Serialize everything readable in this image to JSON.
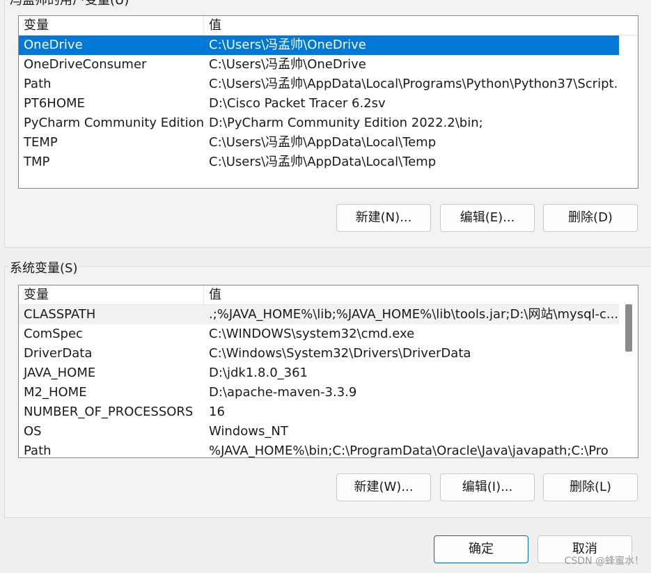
{
  "user_section": {
    "title": "冯孟帅的用户变量(U)",
    "columns": [
      "变量",
      "值"
    ],
    "rows": [
      {
        "name": "OneDrive",
        "value": "C:\\Users\\冯孟帅\\OneDrive"
      },
      {
        "name": "OneDriveConsumer",
        "value": "C:\\Users\\冯孟帅\\OneDrive"
      },
      {
        "name": "Path",
        "value": "C:\\Users\\冯孟帅\\AppData\\Local\\Programs\\Python\\Python37\\Script..."
      },
      {
        "name": "PT6HOME",
        "value": "D:\\Cisco Packet Tracer 6.2sv"
      },
      {
        "name": "PyCharm Community Edition",
        "value": "D:\\PyCharm Community Edition 2022.2\\bin;"
      },
      {
        "name": "TEMP",
        "value": "C:\\Users\\冯孟帅\\AppData\\Local\\Temp"
      },
      {
        "name": "TMP",
        "value": "C:\\Users\\冯孟帅\\AppData\\Local\\Temp"
      }
    ],
    "buttons": {
      "new": "新建(N)...",
      "edit": "编辑(E)...",
      "delete": "删除(D)"
    }
  },
  "system_section": {
    "title": "系统变量(S)",
    "columns": [
      "变量",
      "值"
    ],
    "rows": [
      {
        "name": "CLASSPATH",
        "value": ".;%JAVA_HOME%\\lib;%JAVA_HOME%\\lib\\tools.jar;D:\\网站\\mysql-c..."
      },
      {
        "name": "ComSpec",
        "value": "C:\\WINDOWS\\system32\\cmd.exe"
      },
      {
        "name": "DriverData",
        "value": "C:\\Windows\\System32\\Drivers\\DriverData"
      },
      {
        "name": "JAVA_HOME",
        "value": "D:\\jdk1.8.0_361"
      },
      {
        "name": "M2_HOME",
        "value": "D:\\apache-maven-3.3.9"
      },
      {
        "name": "NUMBER_OF_PROCESSORS",
        "value": "16"
      },
      {
        "name": "OS",
        "value": "Windows_NT"
      },
      {
        "name": "Path",
        "value": "%JAVA_HOME%\\bin;C:\\ProgramData\\Oracle\\Java\\javapath;C:\\Pro"
      }
    ],
    "buttons": {
      "new": "新建(W)...",
      "edit": "编辑(I)...",
      "delete": "删除(L)"
    }
  },
  "dialog_buttons": {
    "ok": "确定",
    "cancel": "取消"
  },
  "watermark": "CSDN @蜂蜜水！",
  "colors": {
    "selection": "#0078d7",
    "primary_border": "#0067c0"
  }
}
